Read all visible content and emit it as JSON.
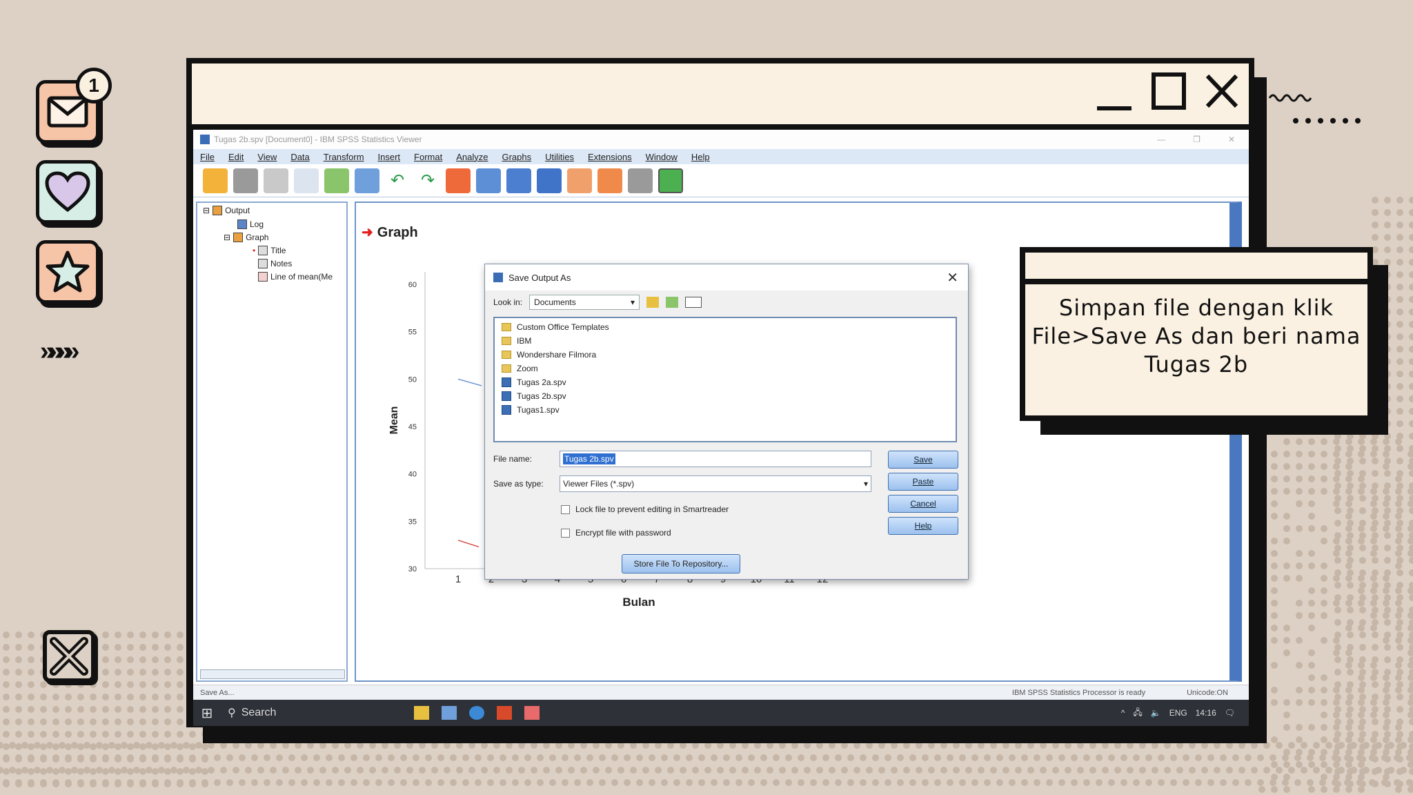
{
  "slide": {
    "badge_count": "1",
    "arrows": "»»»»",
    "note_text": "Simpan file dengan klik File>Save As dan beri nama Tugas 2b",
    "colors": {
      "bg": "#ddd1c5",
      "cream": "#faf1e2",
      "mail": "#f6c4a6",
      "heart": "#d8c7e8",
      "star": "#f6c4a6"
    }
  },
  "frame": {
    "minimize": "_",
    "maximize": "☐",
    "close": "✕"
  },
  "spss": {
    "title": "Tugas 2b.spv [Document0] - IBM SPSS Statistics Viewer",
    "menu": [
      "File",
      "Edit",
      "View",
      "Data",
      "Transform",
      "Insert",
      "Format",
      "Analyze",
      "Graphs",
      "Utilities",
      "Extensions",
      "Window",
      "Help"
    ],
    "tree": {
      "output": "Output",
      "log": "Log",
      "graph": "Graph",
      "title": "Title",
      "notes": "Notes",
      "line": "Line of mean(Me"
    },
    "graph_heading": "Graph",
    "status_left": "Save As...",
    "status_mid": "IBM SPSS Statistics Processor is ready",
    "status_right": "Unicode:ON"
  },
  "chart_data": {
    "type": "line",
    "ylabel": "Mean",
    "xlabel": "Bulan",
    "x": [
      1,
      2,
      3,
      4,
      5,
      6,
      7,
      8,
      9,
      10,
      11,
      12
    ],
    "y_ticks": [
      30,
      35,
      40,
      45,
      50,
      55,
      60
    ],
    "ylim": [
      30,
      60
    ]
  },
  "dialog": {
    "title": "Save Output As",
    "look_in_label": "Look in:",
    "look_in_value": "Documents",
    "files": [
      {
        "name": "Custom Office Templates",
        "kind": "folder"
      },
      {
        "name": "IBM",
        "kind": "folder"
      },
      {
        "name": "Wondershare Filmora",
        "kind": "folder"
      },
      {
        "name": "Zoom",
        "kind": "folder"
      },
      {
        "name": "Tugas 2a.spv",
        "kind": "spv"
      },
      {
        "name": "Tugas 2b.spv",
        "kind": "spv"
      },
      {
        "name": "Tugas1.spv",
        "kind": "spv"
      }
    ],
    "file_name_label": "File name:",
    "file_name_value": "Tugas 2b.spv",
    "save_type_label": "Save as type:",
    "save_type_value": "Viewer Files (*.spv)",
    "lock_label": "Lock file to prevent editing in Smartreader",
    "encrypt_label": "Encrypt file with password",
    "repo_button": "Store File To Repository...",
    "buttons": [
      "Save",
      "Paste",
      "Cancel",
      "Help"
    ]
  },
  "taskbar": {
    "search": "Search",
    "lang": "ENG",
    "time": "14:16"
  }
}
